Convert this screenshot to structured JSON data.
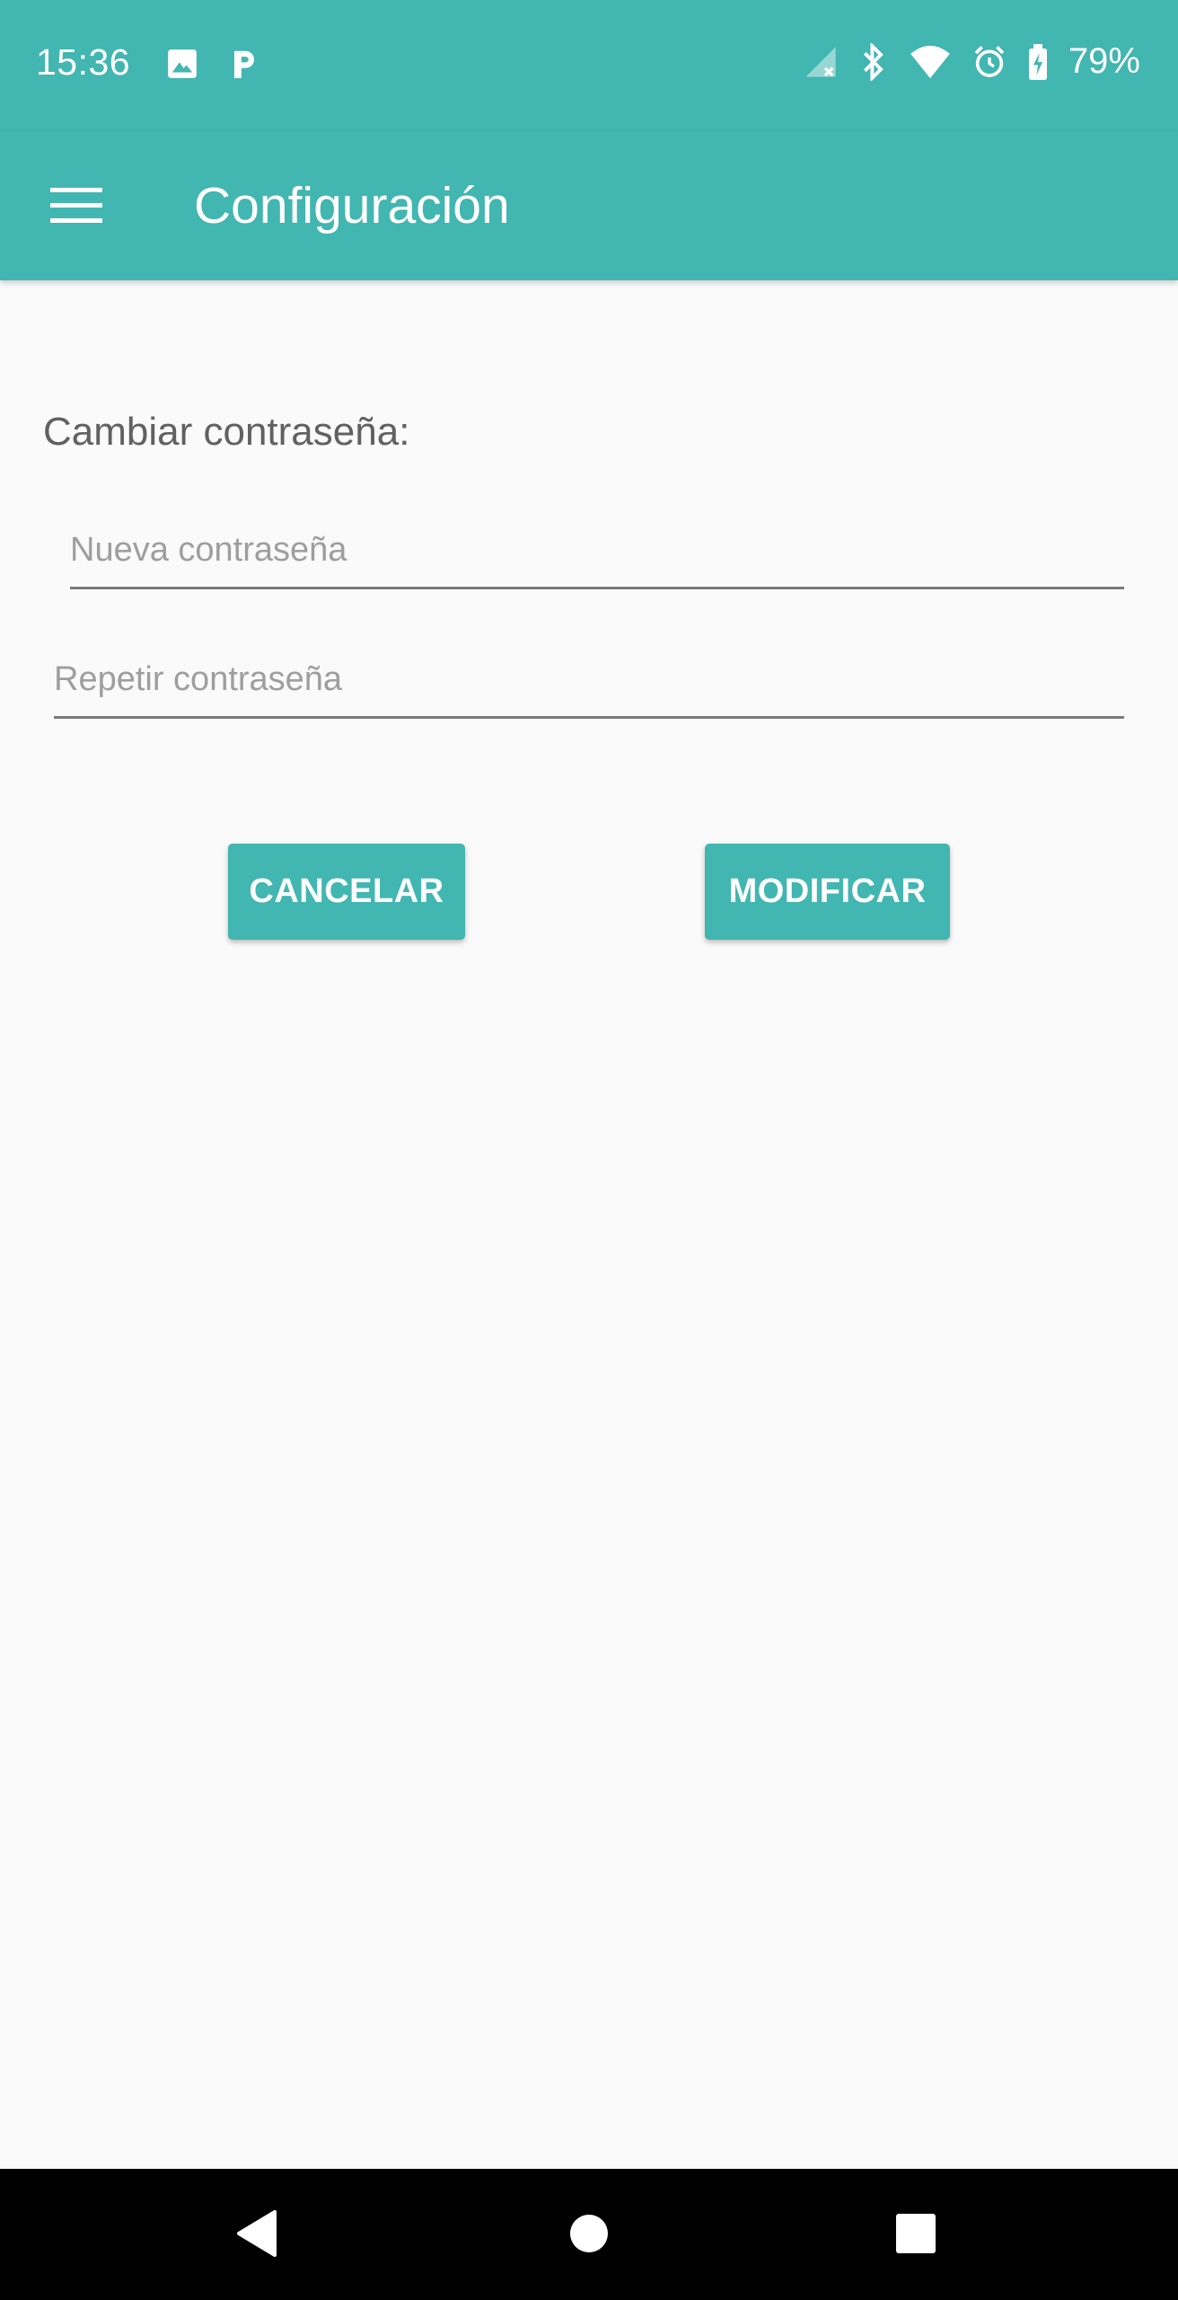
{
  "status_bar": {
    "time": "15:36",
    "left_icons": [
      "image-icon",
      "parking-app-icon"
    ],
    "right_icons": [
      "no-signal-icon",
      "bluetooth-icon",
      "wifi-icon",
      "alarm-icon",
      "battery-charging-icon"
    ],
    "battery_percent": "79%"
  },
  "app_bar": {
    "menu_icon": "hamburger-menu-icon",
    "title": "Configuración"
  },
  "form": {
    "section_label": "Cambiar contraseña:",
    "new_password": {
      "placeholder": "Nueva contraseña",
      "value": ""
    },
    "repeat_password": {
      "placeholder": "Repetir contraseña",
      "value": ""
    }
  },
  "buttons": {
    "cancel_label": "CANCELAR",
    "modify_label": "MODIFICAR"
  },
  "nav_bar": {
    "icons": [
      "back-icon",
      "home-icon",
      "recents-icon"
    ]
  },
  "colors": {
    "primary": "#42B6B0",
    "background": "#FAFAFA",
    "nav_bar": "#000000"
  }
}
